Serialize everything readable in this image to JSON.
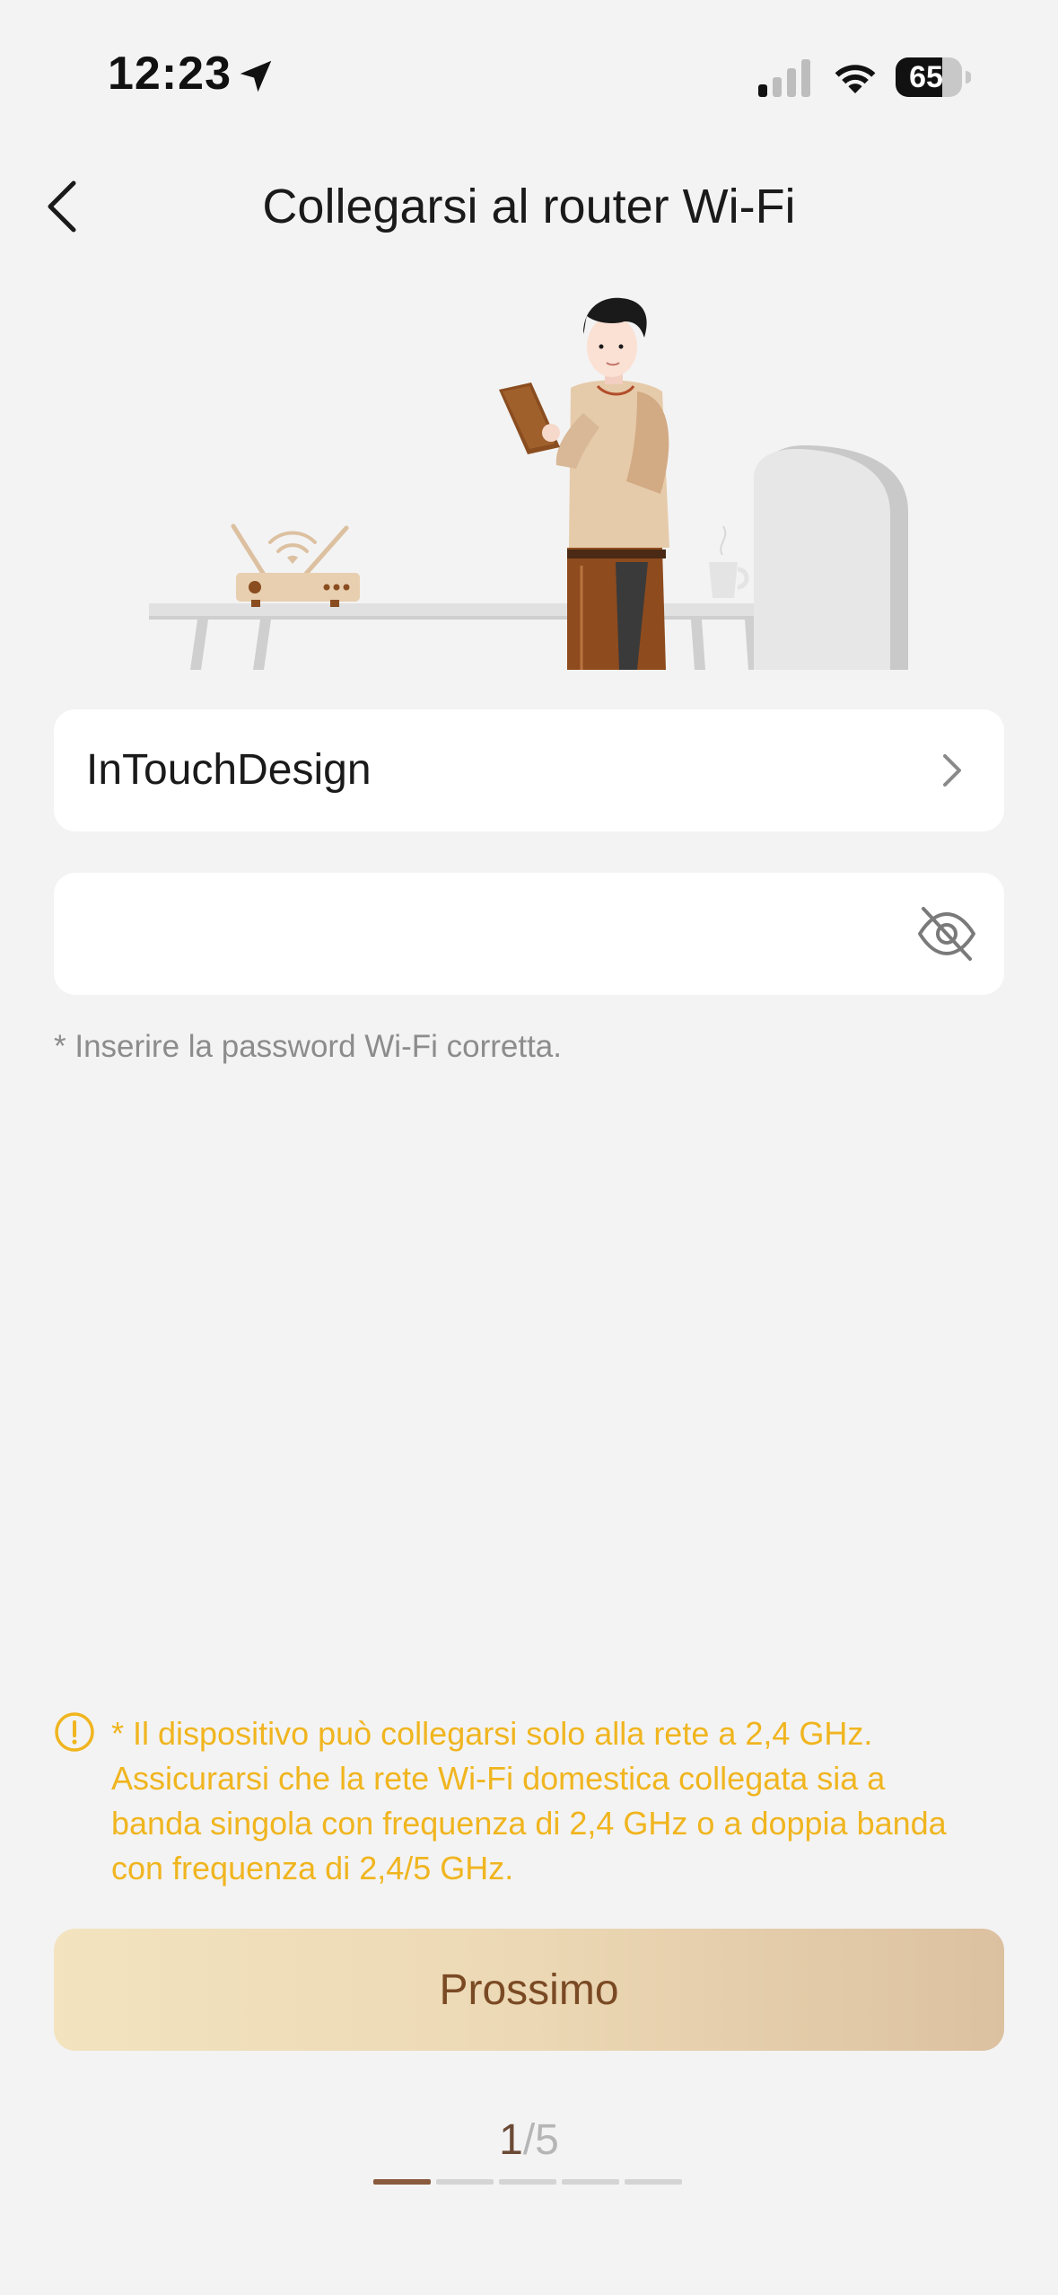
{
  "status_bar": {
    "time": "12:23",
    "battery": "65",
    "icons": [
      "location-arrow-icon",
      "cellular-signal-icon",
      "wifi-icon",
      "battery-icon"
    ]
  },
  "header": {
    "back_icon": "chevron-left-icon",
    "title": "Collegarsi al router Wi-Fi"
  },
  "network": {
    "ssid": "InTouchDesign",
    "chevron_icon": "chevron-right-icon"
  },
  "password": {
    "value": "",
    "placeholder": "",
    "toggle_icon": "eye-off-icon"
  },
  "hint": "* Inserire la password Wi-Fi corretta.",
  "warning": {
    "icon": "alert-circle-icon",
    "text": "* Il dispositivo può collegarsi solo alla rete a 2,4 GHz. Assicurarsi che la rete Wi-Fi domestica collegata sia a banda singola con frequenza di 2,4 GHz o a doppia banda con frequenza di 2,4/5 GHz.",
    "color": "#f0b51f"
  },
  "next_button": {
    "label": "Prossimo"
  },
  "pager": {
    "current": "1",
    "separator": "/",
    "total": "5",
    "active_color": "#8a5a3e"
  }
}
